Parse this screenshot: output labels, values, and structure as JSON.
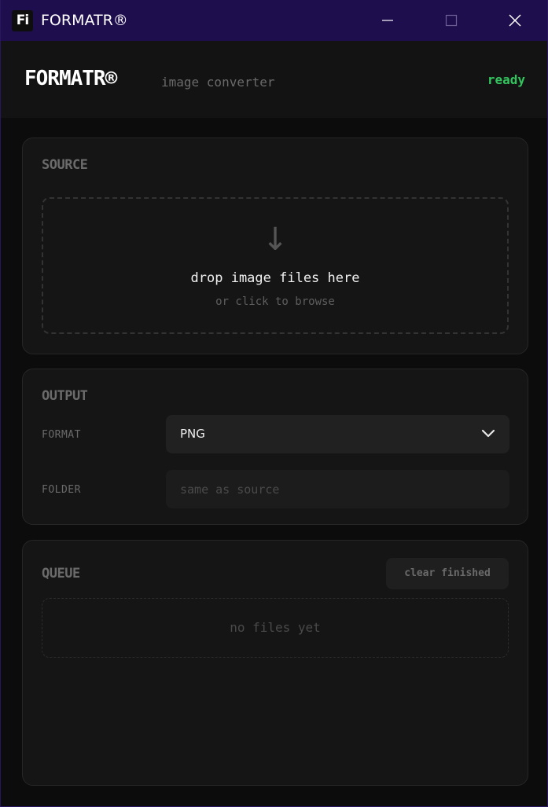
{
  "window": {
    "app_icon_text": "Fi",
    "title": "FORMATR®",
    "controls": {
      "minimize_icon": "minimize-icon",
      "maximize_icon": "maximize-icon",
      "close_icon": "close-icon"
    }
  },
  "header": {
    "logo": "FORMATR®",
    "subtitle": "image converter",
    "status": "ready",
    "status_color": "#33c45e"
  },
  "source": {
    "title": "SOURCE",
    "drop_icon": "arrow-down-icon",
    "drop_title": "drop image files here",
    "drop_subtitle": "or click to browse"
  },
  "output": {
    "title": "OUTPUT",
    "format_label": "FORMAT",
    "format_value": "PNG",
    "folder_label": "FOLDER",
    "folder_placeholder": "same as source",
    "folder_value": ""
  },
  "queue": {
    "title": "QUEUE",
    "clear_button": "clear finished",
    "empty_text": "no files yet"
  },
  "colors": {
    "titlebar": "#1f0e4e",
    "background": "#0c0c0c",
    "panel": "#151515",
    "accent_ready": "#33c45e"
  }
}
